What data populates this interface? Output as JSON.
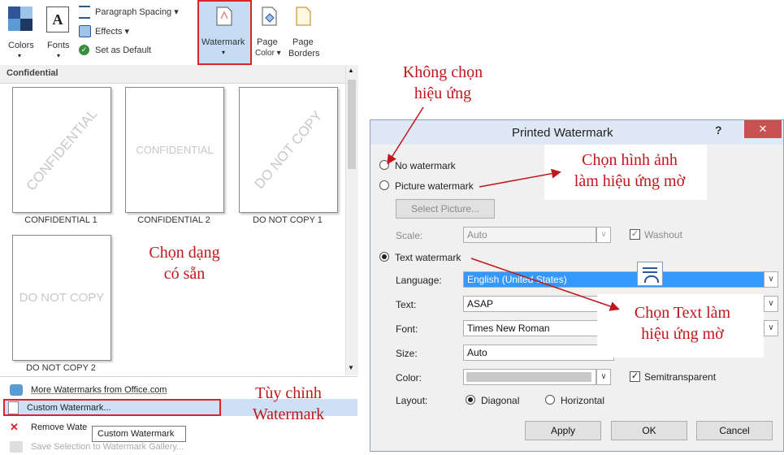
{
  "ribbon": {
    "colors": "Colors",
    "fonts": "Fonts",
    "fonts_glyph": "A",
    "paragraph_spacing": "Paragraph Spacing ▾",
    "effects": "Effects ▾",
    "set_default": "Set as Default",
    "watermark": "Watermark",
    "page_color_1": "Page",
    "page_color_2": "Color ▾",
    "page_borders_1": "Page",
    "page_borders_2": "Borders"
  },
  "gallery": {
    "section": "Confidential",
    "thumbs": [
      {
        "text": "CONFIDENTIAL",
        "caption": "CONFIDENTIAL 1"
      },
      {
        "text": "CONFIDENTIAL",
        "caption": "CONFIDENTIAL 2"
      },
      {
        "text": "DO NOT COPY",
        "caption": "DO NOT COPY 1"
      },
      {
        "text": "DO NOT COPY",
        "caption": "DO NOT COPY 2"
      }
    ]
  },
  "menu": {
    "more": "More Watermarks from Office.com",
    "custom": "Custom Watermark...",
    "remove": "Remove Wate",
    "save": "Save Selection to Watermark Gallery...",
    "tooltip": "Custom Watermark"
  },
  "annotations": {
    "no_effect": [
      "Không chọn",
      "hiệu ứng"
    ],
    "picture": [
      "Chọn hình ảnh",
      "làm hiệu ứng mờ"
    ],
    "preset": [
      "Chọn dạng",
      "có sẵn"
    ],
    "text": [
      "Chọn Text làm",
      "hiệu ứng mờ"
    ],
    "custom": [
      "Tùy chỉnh",
      "Watermark"
    ]
  },
  "dialog": {
    "title": "Printed Watermark",
    "help": "?",
    "close": "✕",
    "no_watermark": "No watermark",
    "picture_watermark": "Picture watermark",
    "select_picture": "Select Picture...",
    "scale_label": "Scale:",
    "scale_value": "Auto",
    "washout": "Washout",
    "text_watermark": "Text watermark",
    "language_label": "Language:",
    "language_value": "English (United States)",
    "text_label": "Text:",
    "text_value": "ASAP",
    "font_label": "Font:",
    "font_value": "Times New Roman",
    "size_label": "Size:",
    "size_value": "Auto",
    "color_label": "Color:",
    "semitransparent": "Semitransparent",
    "layout_label": "Layout:",
    "diagonal": "Diagonal",
    "horizontal": "Horizontal",
    "apply": "Apply",
    "ok": "OK",
    "cancel": "Cancel"
  },
  "colors": {
    "accent_red": "#c0161c",
    "selection_blue": "#3399ff",
    "ribbon_highlight": "#c5dcf3"
  }
}
